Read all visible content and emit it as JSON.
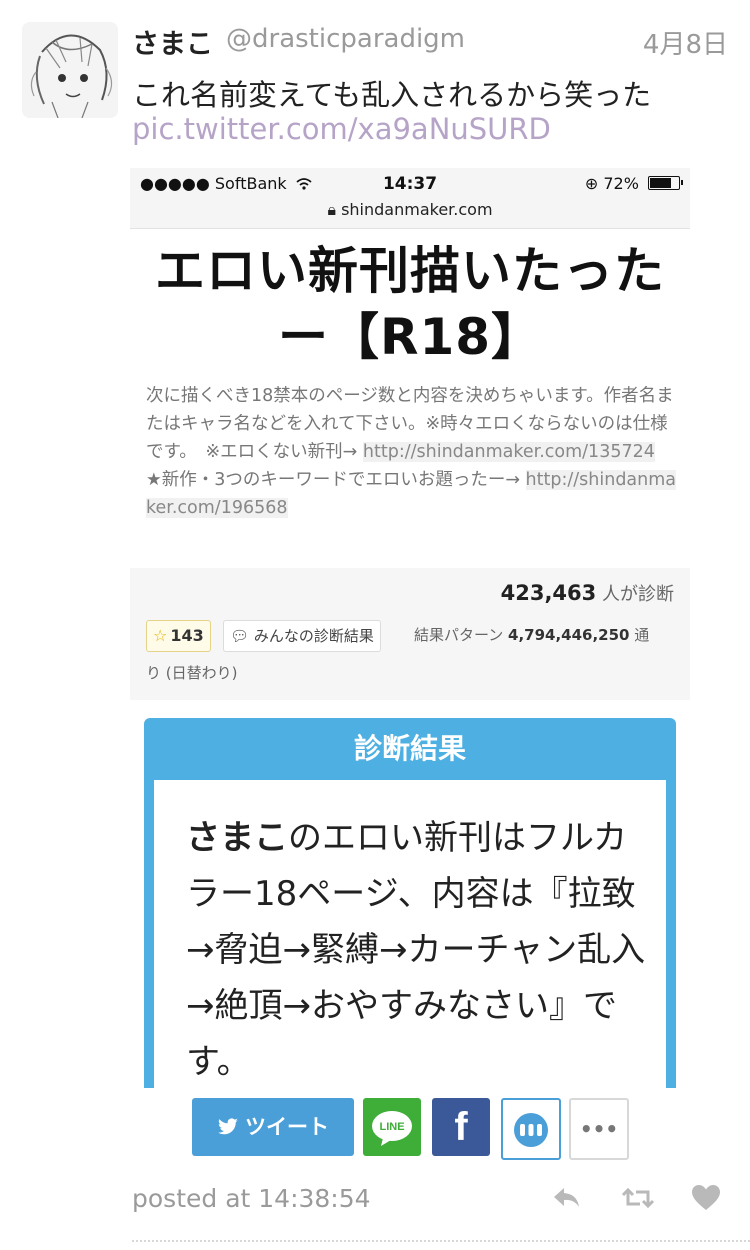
{
  "tweet": {
    "user_name": "さまこ",
    "handle": "@drasticparadigm",
    "date": "4月8日",
    "text": "これ名前変えても乱入されるから笑った",
    "link": "pic.twitter.com/xa9aNuSURD",
    "posted_label": "posted at 14:38:54",
    "icons": {
      "reply": "reply-icon",
      "retweet": "retweet-icon",
      "like": "heart-icon"
    }
  },
  "screenshot": {
    "status_bar": {
      "carrier": "●●●●● SoftBank",
      "time": "14:37",
      "battery": "72%",
      "url": "shindanmaker.com"
    },
    "title": "エロい新刊描いたったー【R18】",
    "description_parts": [
      "次に描くべき18禁本のページ数と内容を決めちゃいます。作者名またはキャラ名などを入れて下さい。※時々エロくならないのは仕様です。　※エロくない新刊→ ",
      "http://shindanmaker.com/135724",
      "　★新作・3つのキーワードでエロいお題ったー→ ",
      "http://shindanmaker.com/196568"
    ],
    "diagnosed_count": "423,463",
    "diagnosed_suffix": " 人が診断",
    "favorites": "143",
    "everyone_results": "みんなの診断結果",
    "pattern_label": "結果パターン ",
    "pattern_count": "4,794,446,250",
    "pattern_suffix": " 通",
    "pattern_suffix_2": "り (日替わり)",
    "result_header": "診断結果",
    "result_name": "さまこ",
    "result_text": "のエロい新刊はフルカラー18ページ、内容は『拉致→脅迫→緊縛→カーチャン乱入→絶頂→おやすみなさい』です。",
    "share": {
      "tweet": "ツイート",
      "line": "LINE",
      "facebook": "f",
      "more": "•••"
    }
  },
  "colors": {
    "link": "#b6a4c8",
    "accent": "#4eb0e2",
    "tweet_button": "#4a9fd9",
    "line": "#3fae38",
    "facebook": "#3b5998"
  }
}
